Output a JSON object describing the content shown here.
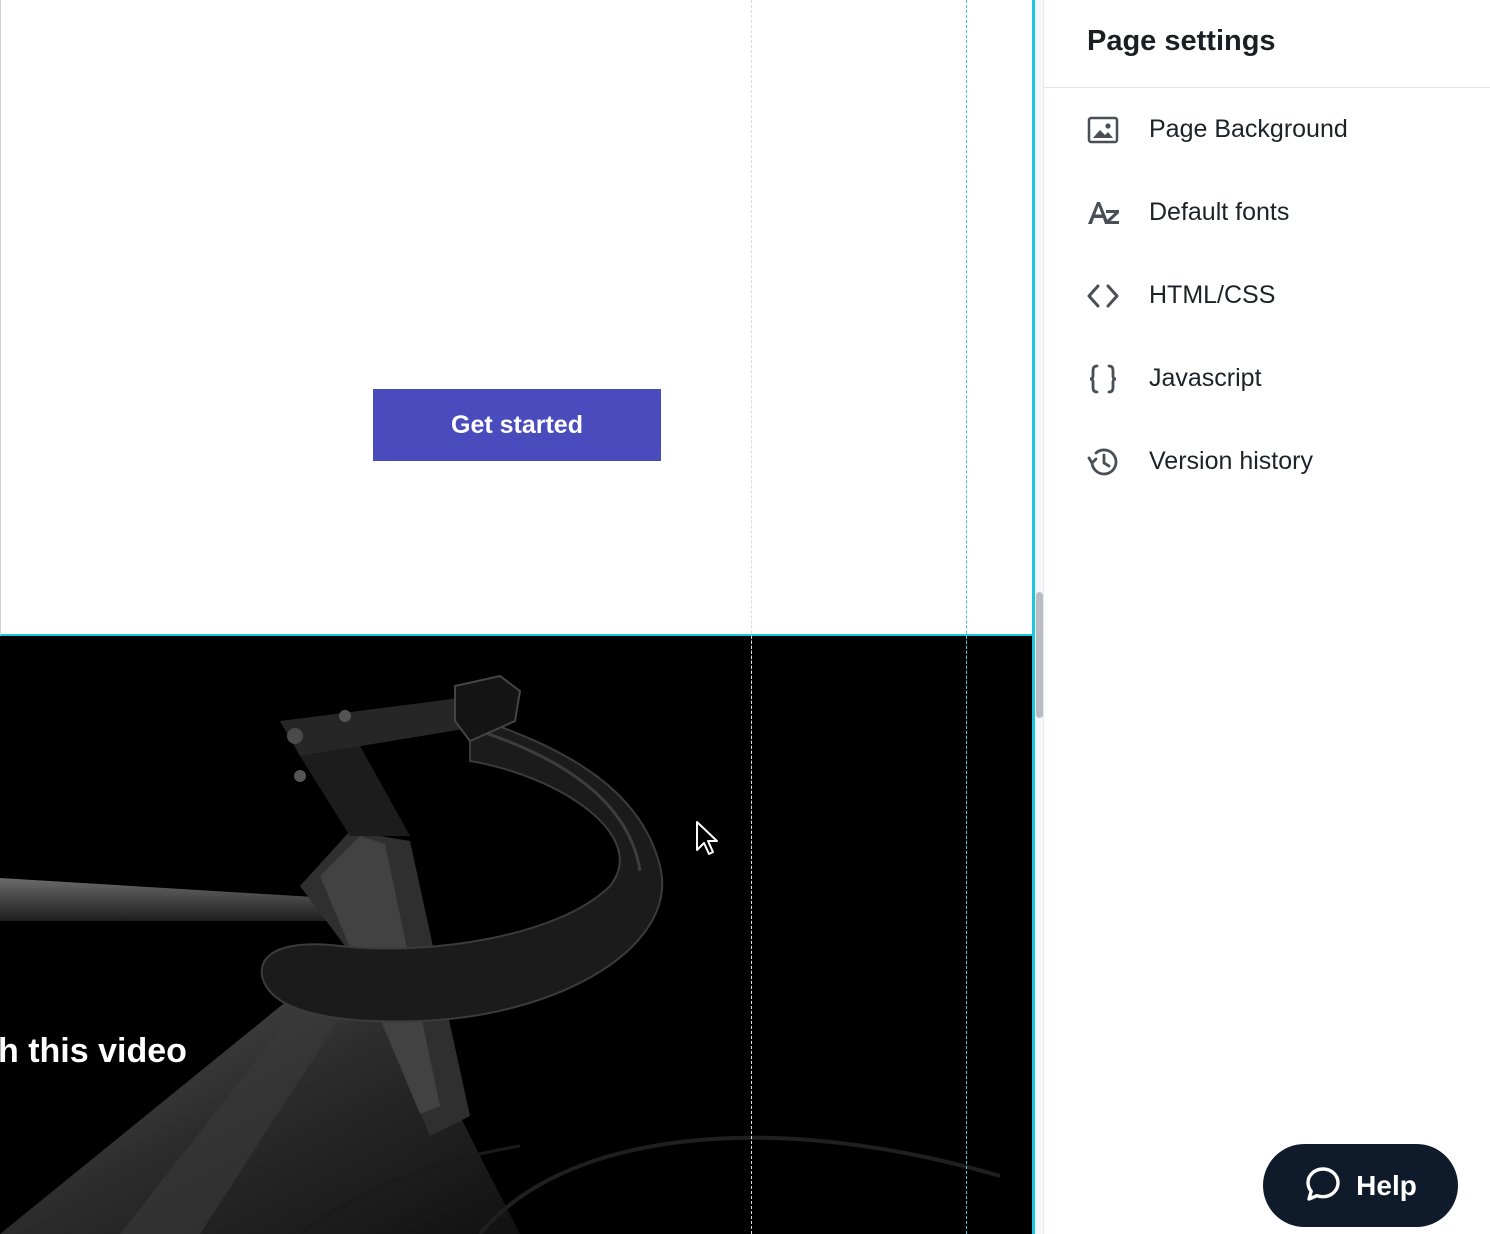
{
  "canvas": {
    "cta_label": "Get started",
    "video_caption": "h this video"
  },
  "panel": {
    "title": "Page settings",
    "items": [
      {
        "label": "Page Background",
        "icon": "image-icon"
      },
      {
        "label": "Default fonts",
        "icon": "font-az-icon"
      },
      {
        "label": "HTML/CSS",
        "icon": "code-brackets-icon"
      },
      {
        "label": "Javascript",
        "icon": "curly-braces-icon"
      },
      {
        "label": "Version history",
        "icon": "history-clock-icon"
      }
    ]
  },
  "help": {
    "label": "Help",
    "icon": "chat-bubble-icon"
  },
  "colors": {
    "accent_selection": "#1cc6dc",
    "cta_background": "#4a4bbd",
    "help_background": "#0f1a2a"
  }
}
